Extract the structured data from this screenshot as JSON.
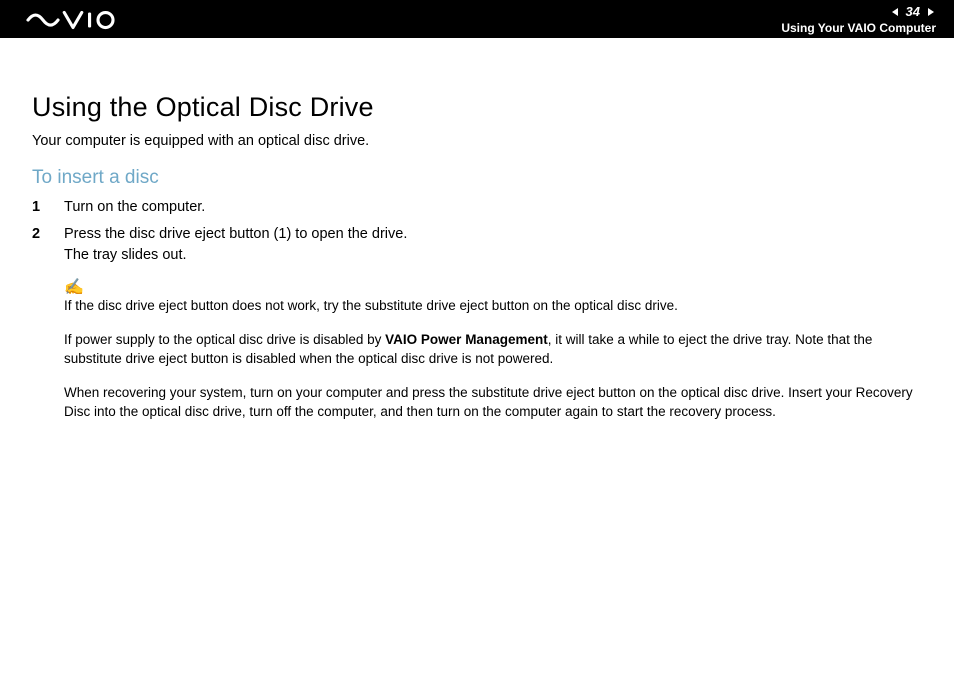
{
  "header": {
    "page_number": "34",
    "breadcrumb": "Using Your VAIO Computer"
  },
  "content": {
    "title": "Using the Optical Disc Drive",
    "intro": "Your computer is equipped with an optical disc drive.",
    "subhead": "To insert a disc",
    "steps": [
      "Turn on the computer.",
      "Press the disc drive eject button (1) to open the drive.\nThe tray slides out."
    ],
    "note_icon": "✍",
    "notes": {
      "n1": "If the disc drive eject button does not work, try the substitute drive eject button on the optical disc drive.",
      "n2_pre": "If power supply to the optical disc drive is disabled by ",
      "n2_bold": "VAIO Power Management",
      "n2_post": ", it will take a while to eject the drive tray. Note that the substitute drive eject button is disabled when the optical disc drive is not powered.",
      "n3": "When recovering your system, turn on your computer and press the substitute drive eject button on the optical disc drive. Insert your Recovery Disc into the optical disc drive, turn off the computer, and then turn on the computer again to start the recovery process."
    }
  }
}
